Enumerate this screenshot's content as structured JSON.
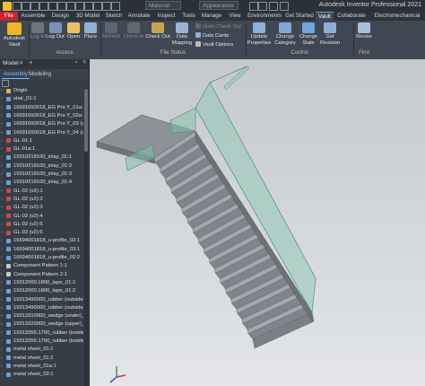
{
  "app": {
    "title": "Autodesk Inventor Professional 2021",
    "material_combo": "Material",
    "appearance_combo": "Appearance"
  },
  "tabs": [
    "File",
    "Assemble",
    "Design",
    "3D Model",
    "Sketch",
    "Annotate",
    "Inspect",
    "Tools",
    "Manage",
    "View",
    "Environments",
    "Get Started",
    "Vault",
    "Collaborate",
    "Electromechanical"
  ],
  "active_tab": "Vault",
  "ribbon": {
    "autodesk_vault": "Autodesk Vault",
    "log_in": "Log In",
    "log_out": "Log Out",
    "open": "Open",
    "place": "Place",
    "refresh": "Refresh",
    "check_in": "Check In",
    "check_out": "Check Out",
    "undo_check_out": "Undo Check Out",
    "data_cards": "Data Cards",
    "vault_options": "Vault Options",
    "data_mapping": "Data Mapping",
    "update_properties": "Update Properties",
    "change_category": "Change Category",
    "change_state": "Change State",
    "get_revision": "Get Revision",
    "revise": "Revise",
    "panels": {
      "access": "Access",
      "file_status": "File Status",
      "control": "Control",
      "find": "Find"
    }
  },
  "browser": {
    "title": "Model",
    "tabs": [
      "Assembly",
      "Modeling"
    ],
    "active_tab": "Assembly",
    "items": [
      "Origin",
      "stair_01:1",
      "16691650018_EG Pro Y_01a:1",
      "16691650018_EG Pro Y_02a:1",
      "16691650018_EG Pro Y_03 (v2)",
      "16691650018_EG Pro Y_04 (v2)",
      "GL-01:1",
      "GL-01a:1",
      "19310218100_inlay_01:1",
      "19310218100_inlay_01:2",
      "19310218100_inlay_01:3",
      "19310218100_inlay_01:4",
      "GL-02 (v2):1",
      "GL-02 (v2):2",
      "GL-02 (v2):3",
      "GL-02 (v2):4",
      "GL-02 (v2):5",
      "GL-02 (v2):6",
      "16694001818_u-profile_02:1",
      "16694001818_u-profile_03:1",
      "16694001818_u-profile_02:2",
      "Component Pattern 1:1",
      "Component Pattern 2:1",
      "19312000.1800_tape_01:1",
      "19312000.1800_tape_01:2",
      "19313490000_rubber (outside)",
      "19313490000_rubber (outside)",
      "19313310000_wedge (under)_0",
      "19313320000_wedge (upper)_0",
      "19313355.1700_rubber (inside)_0",
      "19313355.1700_rubber (inside)_0",
      "metal sheet_01:1",
      "metal sheet_01:2",
      "metal sheet_01a:1",
      "metal sheet_03:1"
    ]
  },
  "colors": {
    "accent": "#6ec3ff",
    "file_tab": "#c1272d",
    "ribbon_bg": "#3f4753",
    "viewport_bg": "#d0d3d7",
    "glass": "#7fbfa8"
  }
}
